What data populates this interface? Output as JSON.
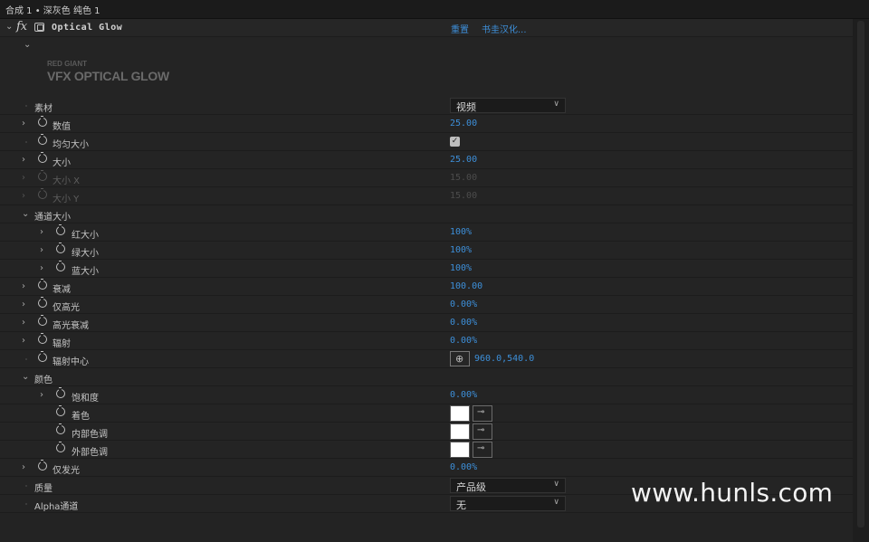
{
  "topbar": {
    "title": "合成 1 • 深灰色 纯色 1"
  },
  "effect": {
    "name": "Optical Glow",
    "reset_label": "重置",
    "about_label": "书圭汉化...",
    "logo_brand": "RED GIANT",
    "logo_product": "VFX OPTICAL GLOW"
  },
  "params": {
    "source": {
      "label": "素材",
      "value": "视频"
    },
    "amount": {
      "label": "数值",
      "value": "25.00"
    },
    "uniform_size": {
      "label": "均匀大小",
      "checked": true,
      "check_glyph": "✓"
    },
    "size": {
      "label": "大小",
      "value": "25.00"
    },
    "size_x": {
      "label": "大小 X",
      "value": "15.00"
    },
    "size_y": {
      "label": "大小 Y",
      "value": "15.00"
    },
    "channel_size": {
      "label": "通道大小"
    },
    "red_size": {
      "label": "红大小",
      "value": "100%"
    },
    "green_size": {
      "label": "绿大小",
      "value": "100%"
    },
    "blue_size": {
      "label": "蓝大小",
      "value": "100%"
    },
    "falloff": {
      "label": "衰减",
      "value": "100.00"
    },
    "highlights_only": {
      "label": "仅高光",
      "value": "0.00%"
    },
    "highlight_falloff": {
      "label": "高光衰减",
      "value": "0.00%"
    },
    "radiation": {
      "label": "辐射",
      "value": "0.00%"
    },
    "radiation_center": {
      "label": "辐射中心",
      "value": "960.0,540.0",
      "point_glyph": "⊕"
    },
    "color": {
      "label": "颜色"
    },
    "saturation": {
      "label": "饱和度",
      "value": "0.00%"
    },
    "tint": {
      "label": "着色",
      "color": "#ffffff"
    },
    "inner_tint": {
      "label": "内部色调",
      "color": "#ffffff"
    },
    "outer_tint": {
      "label": "外部色调",
      "color": "#ffffff"
    },
    "glow_only": {
      "label": "仅发光",
      "value": "0.00%"
    },
    "quality": {
      "label": "质量",
      "value": "产品级"
    },
    "alpha_channel": {
      "label": "Alpha通道",
      "value": "无"
    }
  },
  "icons": {
    "chevron_down": "⌄",
    "chevron_right": "›",
    "caret": "∨",
    "eyedropper": "⊸"
  },
  "colors": {
    "accent": "#3d8fd9",
    "background": "#232323"
  },
  "watermark": "www.hunls.com"
}
